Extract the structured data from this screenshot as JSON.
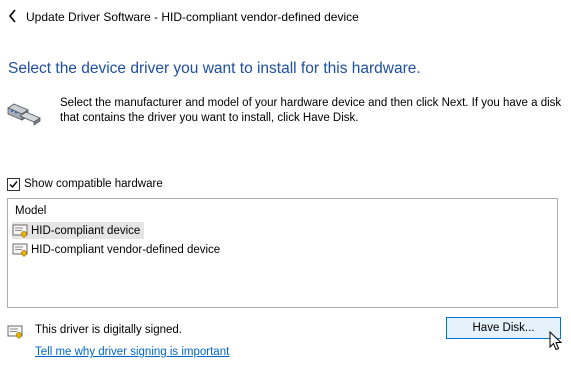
{
  "window": {
    "title": "Update Driver Software - HID-compliant vendor-defined device",
    "icon": "back-arrow-icon"
  },
  "main": {
    "headline": "Select the device driver you want to install for this hardware.",
    "hardware_icon": "hardware-device-icon",
    "instructions": "Select the manufacturer and model of your hardware device and then click Next. If you have a disk that contains the driver you want to install, click Have Disk."
  },
  "compatible_hardware": {
    "label": "Show compatible hardware",
    "checked": true
  },
  "model_list": {
    "header": "Model",
    "items": [
      {
        "label": "HID-compliant device",
        "icon": "driver-icon",
        "selected": true
      },
      {
        "label": "HID-compliant vendor-defined device",
        "icon": "driver-icon",
        "selected": false
      }
    ]
  },
  "footer": {
    "signed_text": "This driver is digitally signed.",
    "signed_icon": "certified-driver-icon",
    "signing_link": "Tell me why driver signing is important",
    "have_disk_label": "Have Disk..."
  },
  "colors": {
    "headline": "#1e4fa0",
    "link": "#0066cc",
    "button_border": "#0078d7",
    "button_bg": "#e5f1fb",
    "selection": "#e5e5e5"
  }
}
